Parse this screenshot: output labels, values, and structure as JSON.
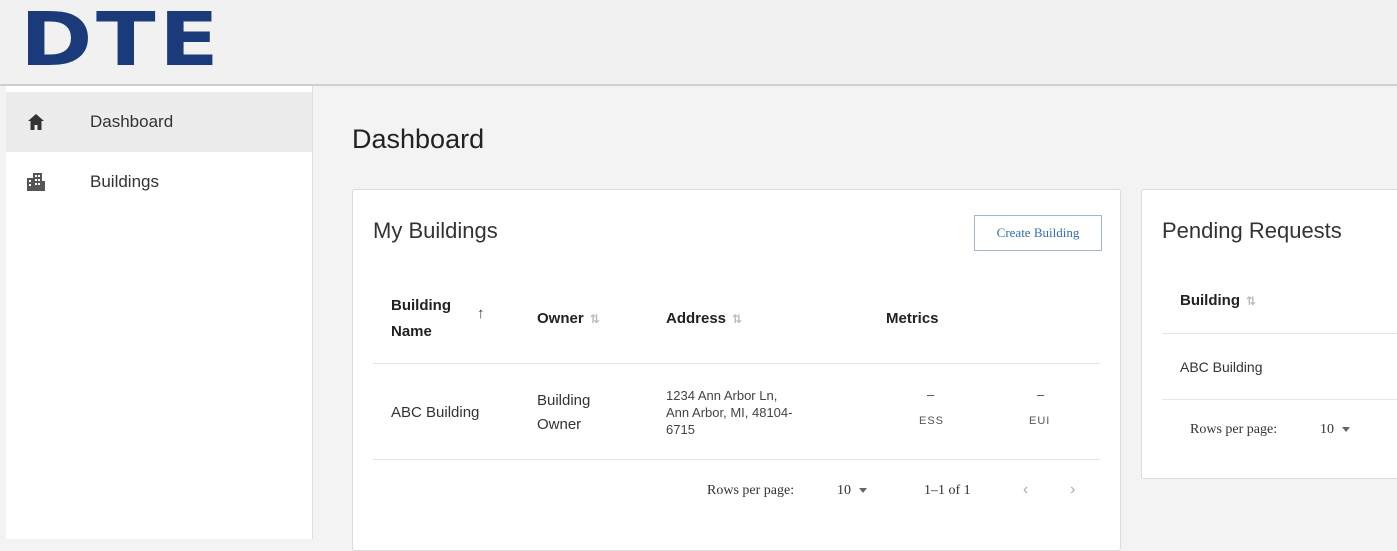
{
  "header": {
    "logo_text": "DTE"
  },
  "sidebar": {
    "items": [
      {
        "label": "Dashboard",
        "icon": "home-icon"
      },
      {
        "label": "Buildings",
        "icon": "building-icon"
      }
    ]
  },
  "main": {
    "title": "Dashboard",
    "my_buildings": {
      "title": "My Buildings",
      "create_label": "Create Building",
      "columns": [
        "Building Name",
        "Owner",
        "Address",
        "Metrics"
      ],
      "column_name_line1": "Building",
      "column_name_line2": "Name",
      "rows": [
        {
          "name": "ABC Building",
          "owner_line1": "Building",
          "owner_line2": "Owner",
          "address_line1": "1234 Ann Arbor Ln,",
          "address_line2": "Ann Arbor, MI, 48104-",
          "address_line3": "6715",
          "ess_value": "–",
          "ess_label": "ESS",
          "eui_value": "–",
          "eui_label": "EUI"
        }
      ],
      "rows_per_page_label": "Rows per page:",
      "rows_per_page_value": "10",
      "range_text": "1–1 of 1"
    },
    "pending_requests": {
      "title": "Pending Requests",
      "column": "Building",
      "rows": [
        "ABC Building"
      ],
      "rows_per_page_label": "Rows per page:",
      "rows_per_page_value": "10"
    }
  },
  "colors": {
    "brand": "#1b3a7a",
    "accent": "#2f6fb5"
  }
}
